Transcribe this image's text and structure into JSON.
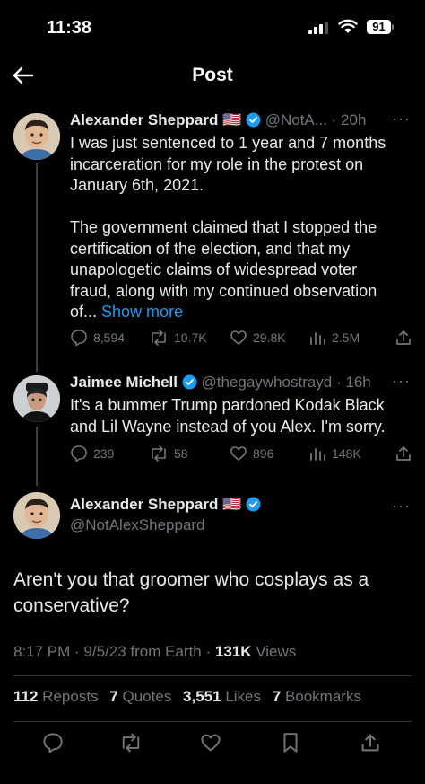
{
  "status_bar": {
    "time": "11:38",
    "battery": "91"
  },
  "nav": {
    "title": "Post"
  },
  "tweets": [
    {
      "name": "Alexander Sheppard",
      "flag": "🇺🇸",
      "handle": "@NotA...",
      "time": "20h",
      "text": "I was just sentenced to 1 year and 7 months incarceration for my role in the protest on January 6th, 2021.",
      "text2": "The government claimed that I stopped the certification of the election, and that my unapologetic claims of widespread voter fraud, along with my continued observation of...",
      "show_more": "Show more",
      "replies": "8,594",
      "reposts": "10.7K",
      "likes": "29.8K",
      "views": "2.5M"
    },
    {
      "name": "Jaimee Michell",
      "handle": "@thegaywhostrayd",
      "time": "16h",
      "text": "It's a bummer Trump pardoned Kodak Black and Lil Wayne instead of you Alex. I'm sorry.",
      "replies": "239",
      "reposts": "58",
      "likes": "896",
      "views": "148K"
    }
  ],
  "main_post": {
    "name": "Alexander Sheppard",
    "flag": "🇺🇸",
    "handle": "@NotAlexSheppard",
    "text": "Aren't you that groomer who cosplays as a conservative?",
    "meta_time": "8:17 PM · 9/5/23 from Earth · ",
    "views_count": "131K",
    "views_label": " Views",
    "reposts_count": "112",
    "reposts_label": "Reposts",
    "quotes_count": "7",
    "quotes_label": "Quotes",
    "likes_count": "3,551",
    "likes_label": "Likes",
    "bookmarks_count": "7",
    "bookmarks_label": "Bookmarks"
  },
  "colors": {
    "accent": "#1d9bf0",
    "muted": "#71767b",
    "background": "#000000",
    "text": "#e7e9ea"
  }
}
